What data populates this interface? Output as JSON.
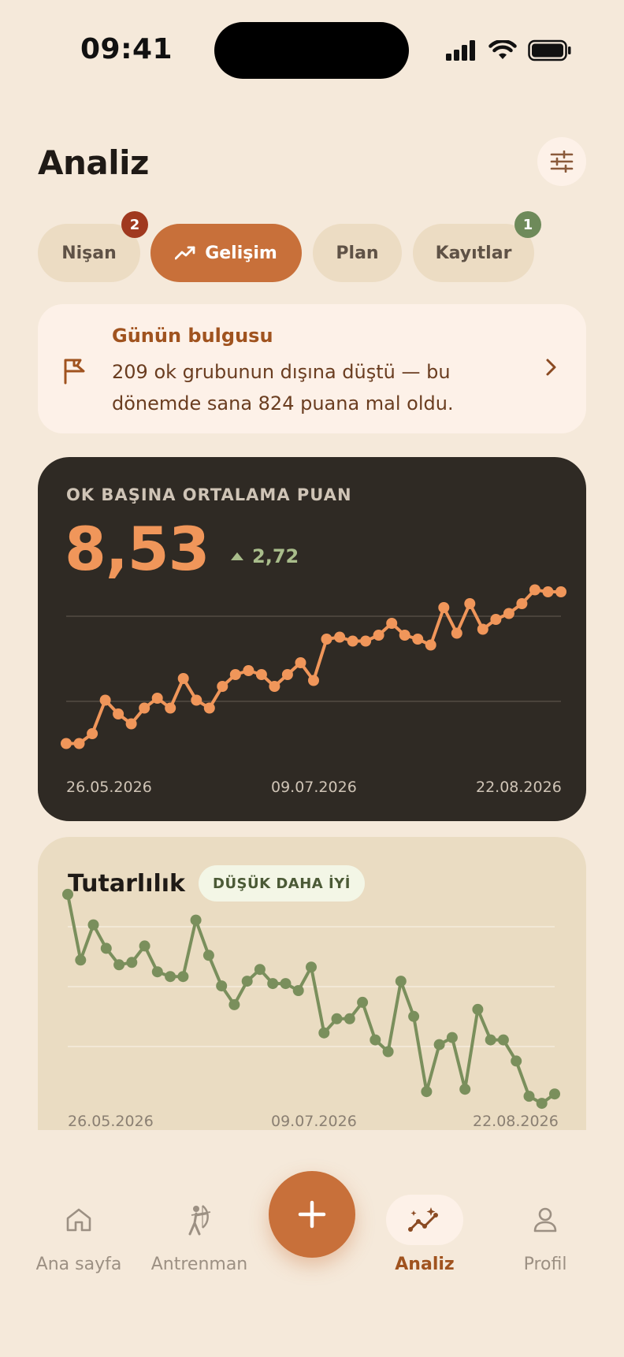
{
  "status_bar": {
    "time": "09:41"
  },
  "header": {
    "title": "Analiz",
    "filter_icon": "sliders-icon"
  },
  "tabs": [
    {
      "label": "Nişan",
      "badge": "2",
      "badge_color": "#a0391f",
      "active": false
    },
    {
      "label": "Gelişim",
      "icon": "trending-up-icon",
      "active": true
    },
    {
      "label": "Plan",
      "active": false
    },
    {
      "label": "Kayıtlar",
      "badge": "1",
      "badge_color": "#6e8a5a",
      "active": false
    }
  ],
  "insight": {
    "icon": "flag-icon",
    "title": "Günün bulgusu",
    "text": "209 ok grubunun dışına düştü — bu dönemde sana 824 puana mal oldu."
  },
  "avg_card": {
    "label": "OK BAŞINA ORTALAMA PUAN",
    "value": "8,53",
    "delta": "2,72",
    "accent": "#f0965a"
  },
  "consistency_card": {
    "title": "Tutarlılık",
    "pill": "DÜŞÜK DAHA İYİ",
    "accent": "#7a8f5c"
  },
  "chart_data": [
    {
      "type": "line",
      "x_labels": [
        "26.05.2026",
        "09.07.2026",
        "22.08.2026"
      ],
      "ylim": [
        0,
        1
      ],
      "grid": true,
      "series": [
        {
          "values": [
            0.09,
            0.09,
            0.14,
            0.31,
            0.24,
            0.19,
            0.27,
            0.32,
            0.27,
            0.42,
            0.31,
            0.27,
            0.38,
            0.44,
            0.46,
            0.44,
            0.38,
            0.44,
            0.5,
            0.41,
            0.62,
            0.63,
            0.61,
            0.61,
            0.64,
            0.7,
            0.64,
            0.62,
            0.59,
            0.78,
            0.65,
            0.8,
            0.67,
            0.72,
            0.75,
            0.8,
            0.87,
            0.86,
            0.86
          ]
        }
      ]
    },
    {
      "type": "line",
      "x_labels": [
        "26.05.2026",
        "09.07.2026",
        "22.08.2026"
      ],
      "ylim": [
        0,
        1
      ],
      "grid": true,
      "series": [
        {
          "values": [
            0.93,
            0.65,
            0.8,
            0.7,
            0.63,
            0.64,
            0.71,
            0.6,
            0.58,
            0.58,
            0.82,
            0.67,
            0.54,
            0.46,
            0.56,
            0.61,
            0.55,
            0.55,
            0.52,
            0.62,
            0.34,
            0.4,
            0.4,
            0.47,
            0.31,
            0.26,
            0.56,
            0.41,
            0.09,
            0.29,
            0.32,
            0.1,
            0.44,
            0.31,
            0.31,
            0.22,
            0.07,
            0.04,
            0.08
          ]
        }
      ]
    }
  ],
  "bottom_nav": {
    "items": [
      {
        "label": "Ana sayfa",
        "icon": "home-icon"
      },
      {
        "label": "Antrenman",
        "icon": "archer-icon"
      },
      {
        "label": "Analiz",
        "icon": "analytics-icon",
        "active": true
      },
      {
        "label": "Profil",
        "icon": "person-icon"
      }
    ],
    "fab_icon": "plus-icon"
  }
}
